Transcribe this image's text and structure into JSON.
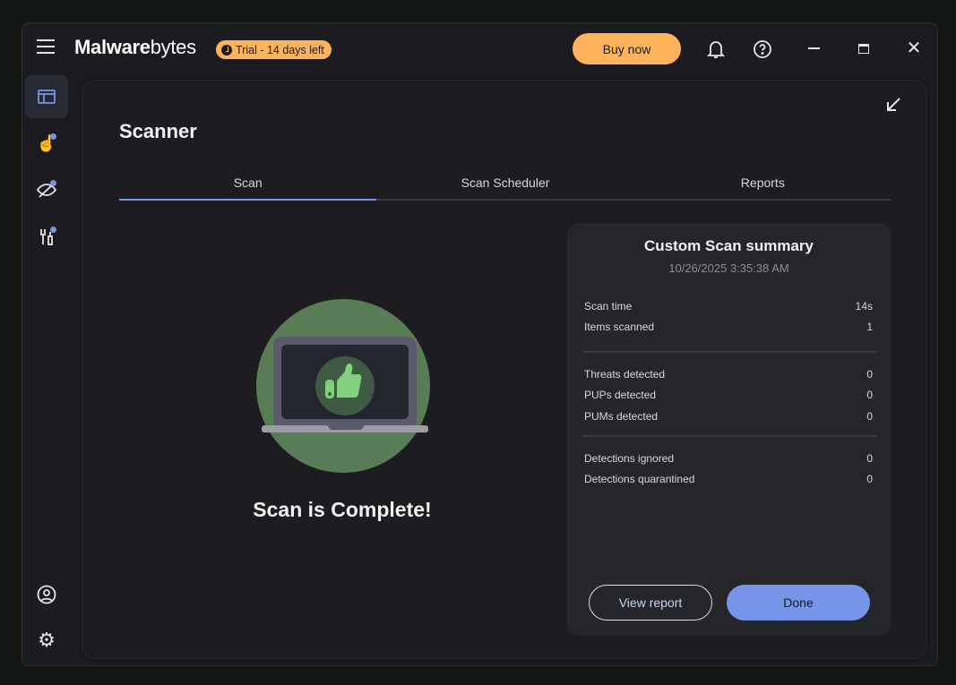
{
  "header": {
    "brand_bold": "Malware",
    "brand_light": "bytes",
    "trial_badge": "Trial - 14 days left",
    "buy_label": "Buy now"
  },
  "scanner": {
    "title": "Scanner",
    "tabs": [
      {
        "label": "Scan"
      },
      {
        "label": "Scan Scheduler"
      },
      {
        "label": "Reports"
      }
    ],
    "status": "Scan is Complete!"
  },
  "summary": {
    "title": "Custom Scan summary",
    "date": "10/26/2025 3:35:38 AM",
    "rows": [
      {
        "label": "Scan time",
        "value": "14s"
      },
      {
        "label": "Items scanned",
        "value": "1"
      },
      {
        "label": "Threats detected",
        "value": "0"
      },
      {
        "label": "PUPs detected",
        "value": "0"
      },
      {
        "label": "PUMs detected",
        "value": "0"
      },
      {
        "label": "Detections ignored",
        "value": "0"
      },
      {
        "label": "Detections quarantined",
        "value": "0"
      }
    ],
    "view_report": "View report",
    "done": "Done"
  },
  "colors": {
    "accent": "#7694e8",
    "brand_orange": "#ffb45b",
    "success_green": "#587c55"
  }
}
